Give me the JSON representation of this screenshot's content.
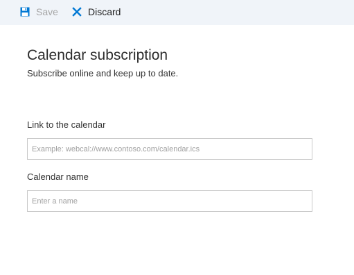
{
  "toolbar": {
    "save_label": "Save",
    "discard_label": "Discard",
    "save_icon": "save-icon",
    "discard_icon": "close-icon",
    "colors": {
      "background": "#f0f4f9",
      "save_icon": "#0078d4",
      "save_text_disabled": "#a6a6a6",
      "discard_icon": "#0078d4"
    }
  },
  "page": {
    "title": "Calendar subscription",
    "subtitle": "Subscribe online and keep up to date."
  },
  "form": {
    "link_label": "Link to the calendar",
    "link_placeholder": "Example: webcal://www.contoso.com/calendar.ics",
    "link_value": "",
    "name_label": "Calendar name",
    "name_placeholder": "Enter a name",
    "name_value": ""
  }
}
